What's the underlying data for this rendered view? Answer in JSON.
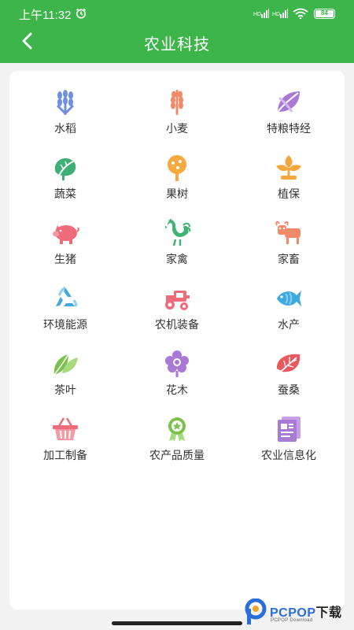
{
  "status": {
    "time": "上午11:32",
    "battery": "84"
  },
  "header": {
    "title": "农业科技"
  },
  "categories": [
    {
      "label": "水稻",
      "icon": "rice-icon"
    },
    {
      "label": "小麦",
      "icon": "wheat-icon"
    },
    {
      "label": "特粮特经",
      "icon": "special-crop-icon"
    },
    {
      "label": "蔬菜",
      "icon": "vegetable-icon"
    },
    {
      "label": "果树",
      "icon": "fruit-tree-icon"
    },
    {
      "label": "植保",
      "icon": "plant-protection-icon"
    },
    {
      "label": "生猪",
      "icon": "pig-icon"
    },
    {
      "label": "家禽",
      "icon": "rooster-icon"
    },
    {
      "label": "家畜",
      "icon": "cattle-icon"
    },
    {
      "label": "环境能源",
      "icon": "recycle-icon"
    },
    {
      "label": "农机装备",
      "icon": "tractor-icon"
    },
    {
      "label": "水产",
      "icon": "fish-icon"
    },
    {
      "label": "茶叶",
      "icon": "tea-leaf-icon"
    },
    {
      "label": "花木",
      "icon": "flower-icon"
    },
    {
      "label": "蚕桑",
      "icon": "mulberry-leaf-icon"
    },
    {
      "label": "加工制备",
      "icon": "basket-icon"
    },
    {
      "label": "农产品质量",
      "icon": "quality-badge-icon"
    },
    {
      "label": "农业信息化",
      "icon": "document-icon"
    }
  ],
  "watermark": {
    "brand": "PCPOP",
    "brand_suffix": "下载",
    "sub": "PCPOP Download"
  },
  "colors": {
    "header": "#3db54a",
    "background": "#f2f2f2",
    "card": "#ffffff"
  }
}
